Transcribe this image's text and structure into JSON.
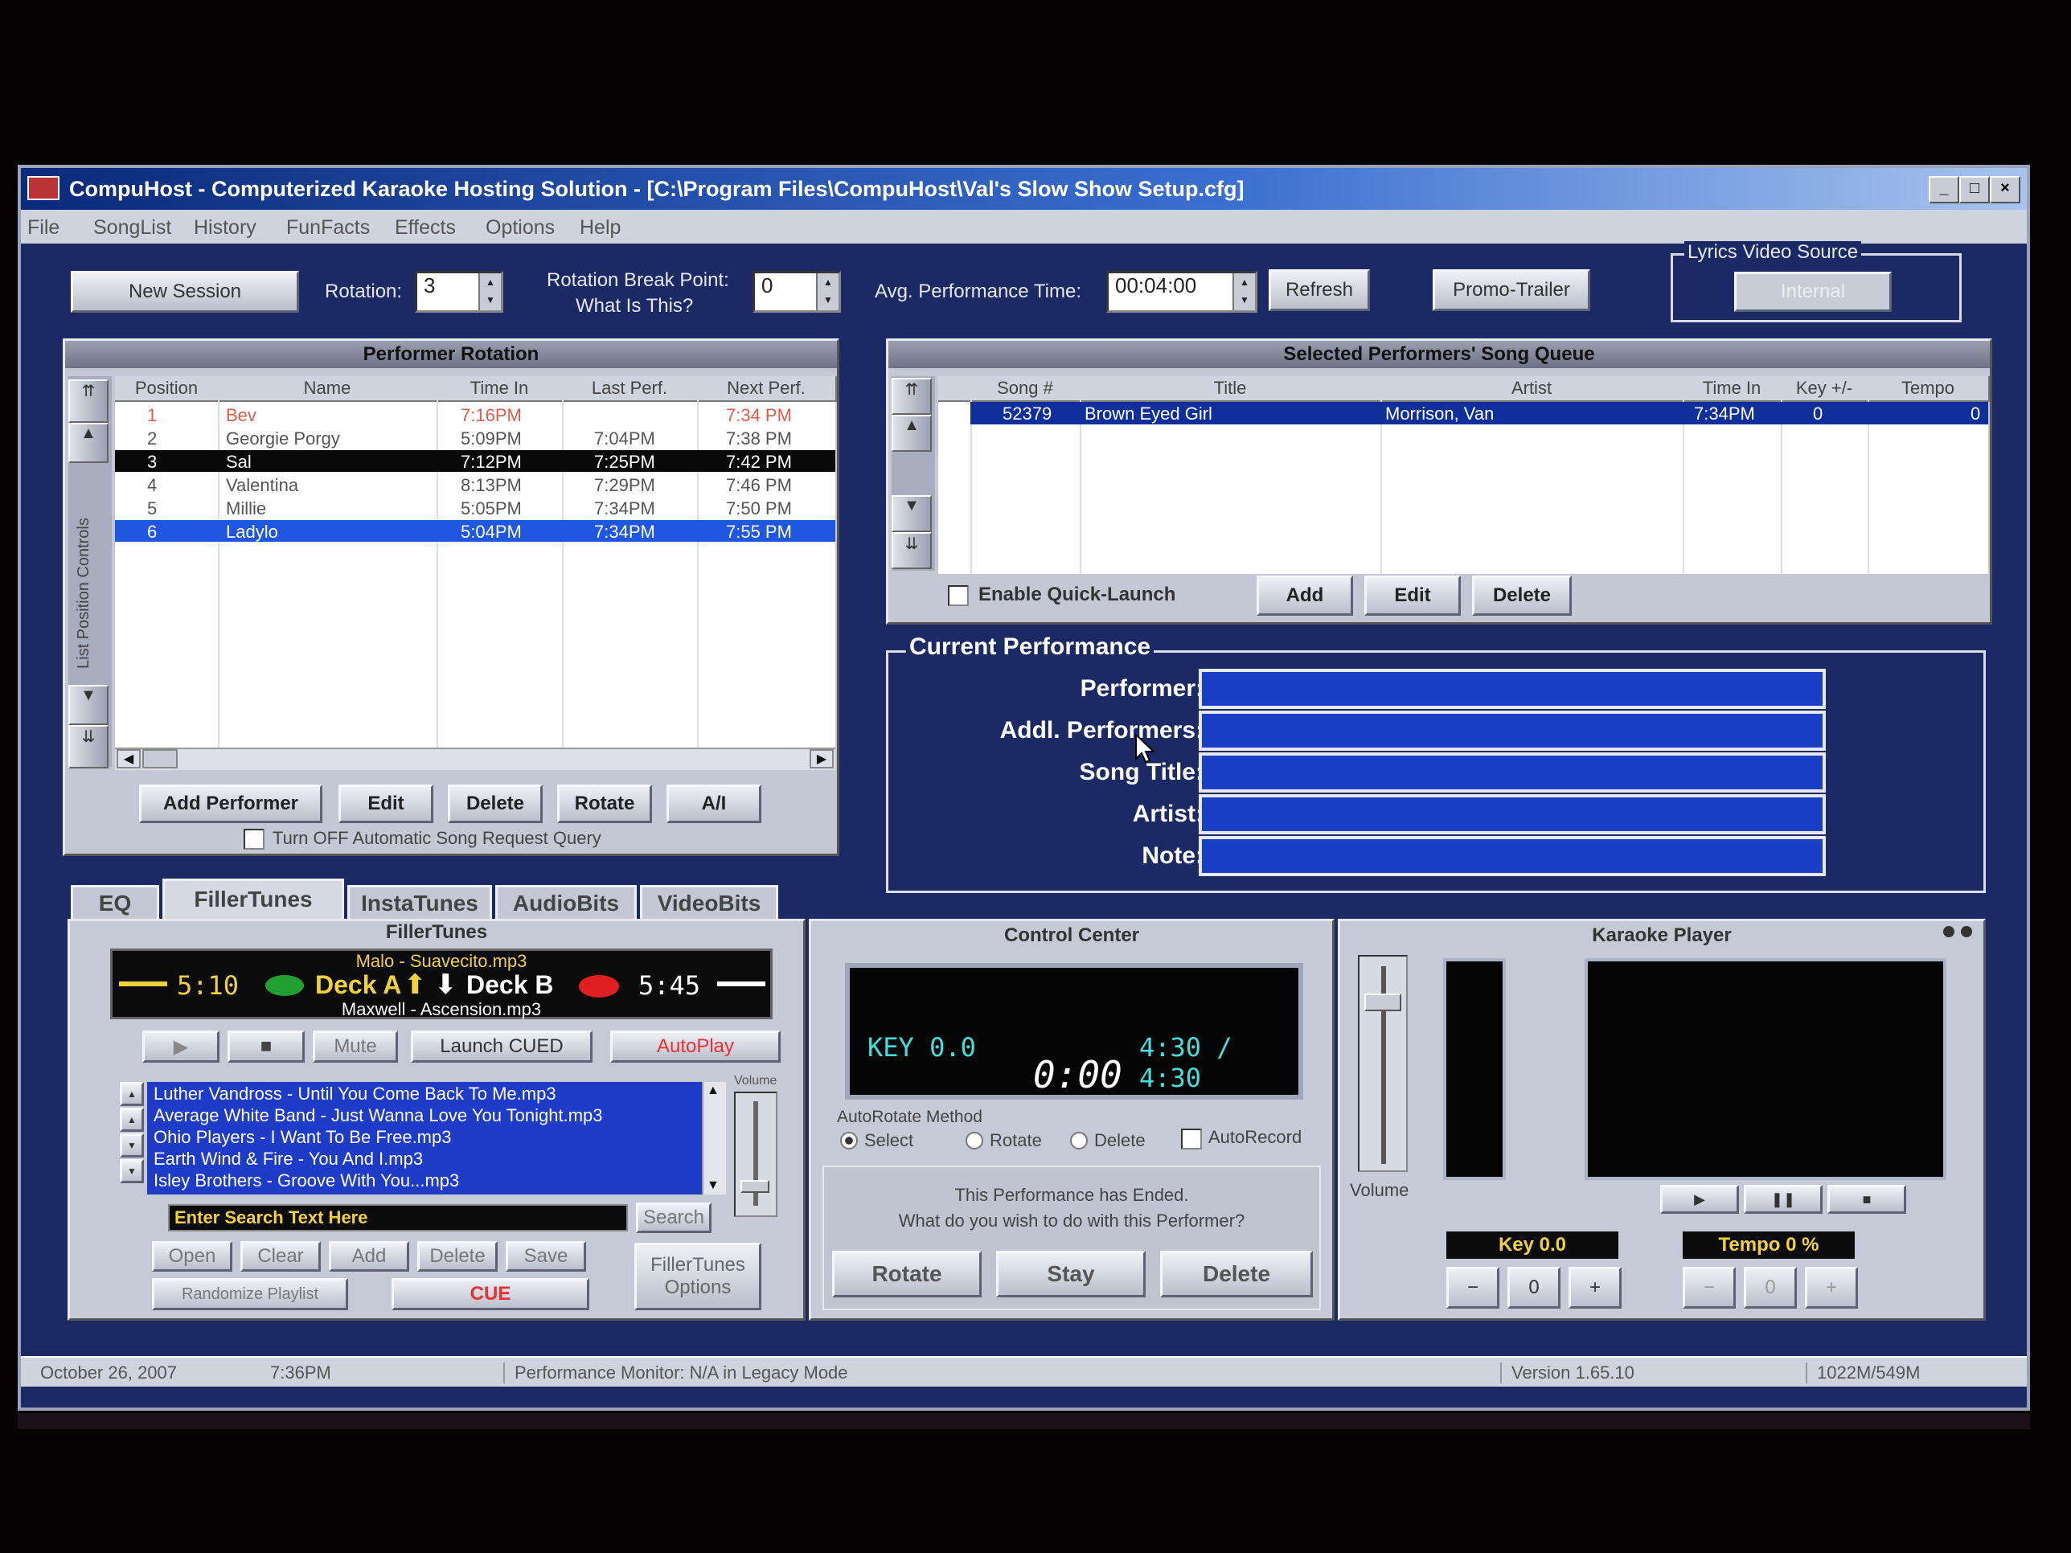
{
  "window": {
    "title": "CompuHost - Computerized Karaoke Hosting Solution - [C:\\Program Files\\CompuHost\\Val's Slow Show Setup.cfg]",
    "controls": [
      "_",
      "□",
      "×"
    ]
  },
  "menu": [
    "File",
    "SongList",
    "History",
    "FunFacts",
    "Effects",
    "Options",
    "Help"
  ],
  "toolbar": {
    "new_session": "New Session",
    "rotation_label": "Rotation:",
    "rotation_value": "3",
    "break_point_label": "Rotation Break Point:",
    "what_is_this": "What Is This?",
    "break_point_value": "0",
    "avg_time_label": "Avg. Performance Time:",
    "avg_time_value": "00:04:00",
    "refresh": "Refresh",
    "promo_trailer": "Promo-Trailer",
    "lyrics_video_source": "Lyrics Video Source",
    "lyrics_button": "Internal"
  },
  "rotation": {
    "title": "Performer Rotation",
    "side_label": "List Position Controls",
    "columns": [
      "Position",
      "Name",
      "Time In",
      "Last Perf.",
      "Next Perf."
    ],
    "rows": [
      {
        "pos": "1",
        "name": "Bev",
        "time_in": "7:16PM",
        "last": "",
        "next": "7:34 PM",
        "style": "red"
      },
      {
        "pos": "2",
        "name": "Georgie Porgy",
        "time_in": "5:09PM",
        "last": "7:04PM",
        "next": "7:38 PM",
        "style": "normal"
      },
      {
        "pos": "3",
        "name": "Sal",
        "time_in": "7:12PM",
        "last": "7:25PM",
        "next": "7:42 PM",
        "style": "black"
      },
      {
        "pos": "4",
        "name": "Valentina",
        "time_in": "8:13PM",
        "last": "7:29PM",
        "next": "7:46 PM",
        "style": "normal"
      },
      {
        "pos": "5",
        "name": "Millie",
        "time_in": "5:05PM",
        "last": "7:34PM",
        "next": "7:50 PM",
        "style": "normal"
      },
      {
        "pos": "6",
        "name": "Ladylo",
        "time_in": "5:04PM",
        "last": "7:34PM",
        "next": "7:55 PM",
        "style": "blue"
      }
    ],
    "buttons": [
      "Add Performer",
      "Edit",
      "Delete",
      "Rotate",
      "A/I"
    ],
    "query_option": "Turn OFF Automatic Song Request Query"
  },
  "queue": {
    "title": "Selected Performers' Song Queue",
    "columns": [
      "Song #",
      "Title",
      "Artist",
      "Time In",
      "Key +/-",
      "Tempo"
    ],
    "rows": [
      {
        "song": "52379",
        "title": "Brown Eyed Girl",
        "artist": "Morrison, Van",
        "time_in": "7:34PM",
        "key": "0",
        "tempo": "0"
      }
    ],
    "quick_launch": "Enable Quick-Launch",
    "buttons": [
      "Add",
      "Edit",
      "Delete"
    ]
  },
  "current": {
    "title": "Current Performance",
    "labels": [
      "Performer:",
      "Addl. Performers:",
      "Song Title:",
      "Artist:",
      "Note:"
    ]
  },
  "tabs": [
    "EQ",
    "FillerTunes",
    "InstaTunes",
    "AudioBits",
    "VideoBits"
  ],
  "filler": {
    "title": "FillerTunes",
    "deck_a_song": "Malo - Suavecito.mp3",
    "deck_b_song": "Maxwell - Ascension.mp3",
    "time_a": "5:10",
    "time_b": "5:45",
    "deck_a": "Deck A",
    "deck_b": "Deck B",
    "controls": [
      "▶",
      "■",
      "Mute",
      "Launch CUED",
      "AutoPlay"
    ],
    "volume_label": "Volume",
    "playlist": [
      "Luther Vandross - Until You Come Back To Me.mp3",
      "Average White Band - Just Wanna Love You Tonight.mp3",
      "Ohio Players - I Want To Be Free.mp3",
      "Earth Wind & Fire - You And I.mp3",
      "Isley Brothers - Groove With You...mp3"
    ],
    "search_placeholder": "Enter Search Text Here",
    "search_button": "Search",
    "row_buttons": [
      "Open",
      "Clear",
      "Add",
      "Delete",
      "Save"
    ],
    "randomize": "Randomize Playlist",
    "cue": "CUE",
    "options": [
      "FillerTunes",
      "Options"
    ]
  },
  "control_center": {
    "title": "Control Center",
    "key": "KEY  0.0",
    "elapsed": "4:30 / 4:30",
    "remaining": "0:00",
    "autorotate_label": "AutoRotate Method",
    "methods": [
      "Select",
      "Rotate",
      "Delete"
    ],
    "autorecord": "AutoRecord",
    "message_line1": "This Performance has Ended.",
    "message_line2": "What do you wish to do with this Performer?",
    "buttons": [
      "Rotate",
      "Stay",
      "Delete"
    ]
  },
  "player": {
    "title": "Karaoke Player",
    "volume_label": "Volume",
    "key_label": "Key 0.0",
    "tempo_label": "Tempo  0 %",
    "transport": [
      "▶",
      "❚❚",
      "■"
    ],
    "adjust": [
      "−",
      "0",
      "+"
    ],
    "volume_level": 0.85
  },
  "status": {
    "date": "October 26, 2007",
    "time": "7:36PM",
    "monitor": "Performance Monitor: N/A in Legacy Mode",
    "version": "Version 1.65.10",
    "memory": "1022M/549M"
  },
  "colors": {
    "window_bg": "#1b2a64",
    "selection_blue": "#1f57e0",
    "field_blue": "#1b3fc4",
    "lcd_cyan": "#3fe0e0",
    "deck_yellow": "#f2d13a"
  }
}
